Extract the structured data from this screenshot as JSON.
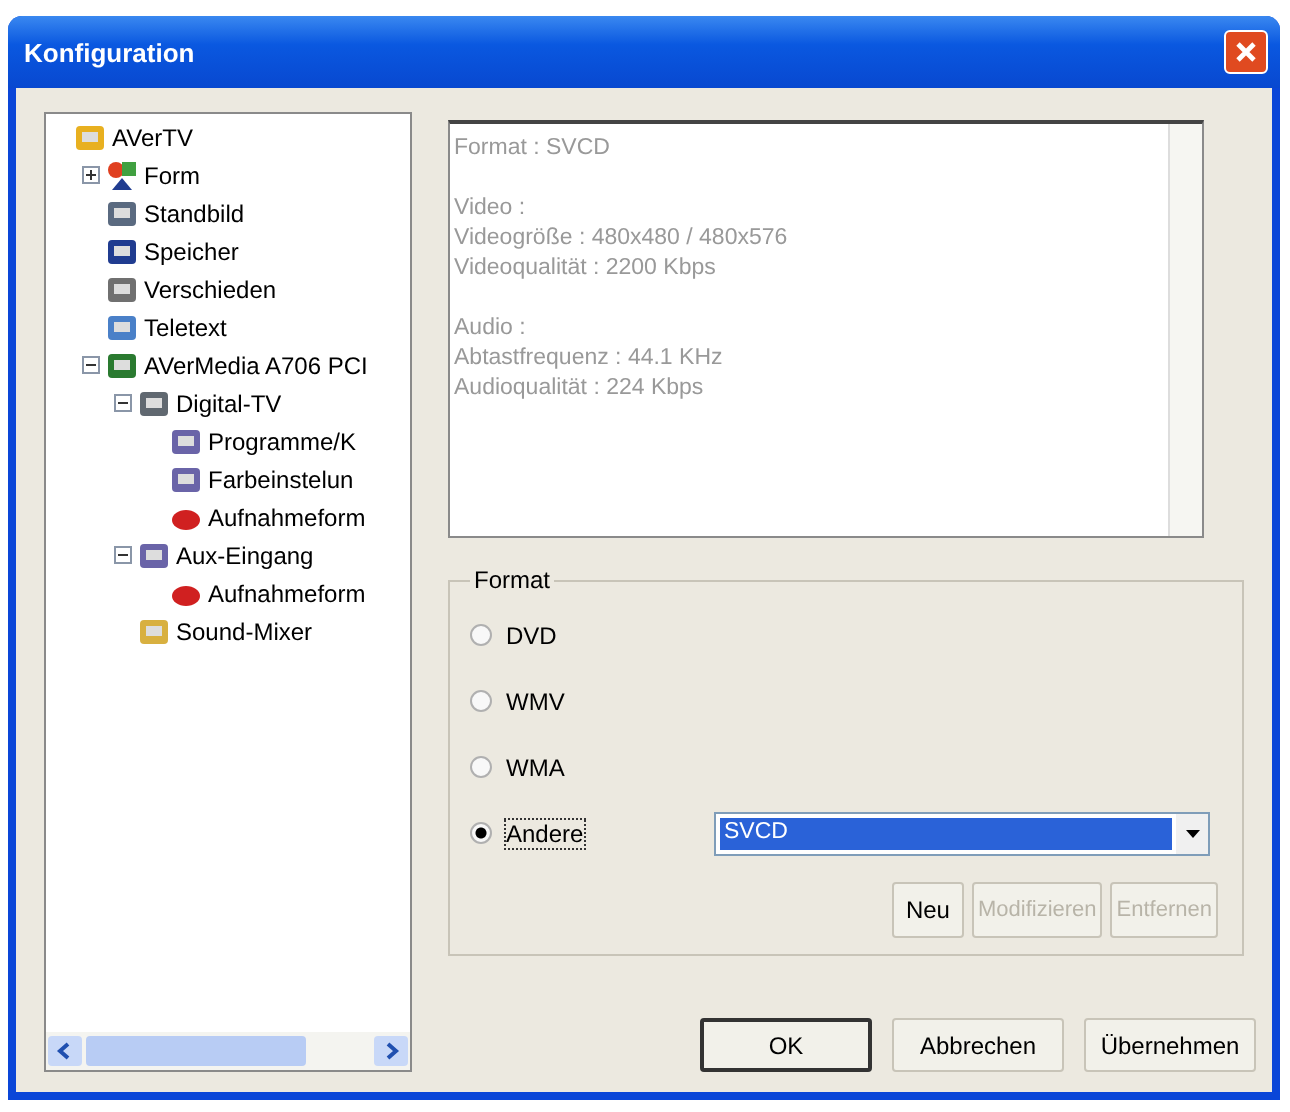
{
  "window": {
    "title": "Konfiguration"
  },
  "tree": [
    {
      "label": "AVerTV",
      "children": [
        {
          "label": "Form",
          "expanded": false
        },
        {
          "label": "Standbild"
        },
        {
          "label": "Speicher"
        },
        {
          "label": "Verschieden"
        },
        {
          "label": "Teletext"
        },
        {
          "label": "AVerMedia A706 PCI",
          "expanded": true,
          "children": [
            {
              "label": "Digital-TV",
              "expanded": true,
              "children": [
                {
                  "label": "Programme/K"
                },
                {
                  "label": "Farbeinstelun"
                },
                {
                  "label": "Aufnahmeform"
                }
              ]
            },
            {
              "label": "Aux-Eingang",
              "expanded": true,
              "children": [
                {
                  "label": "Aufnahmeform"
                }
              ]
            },
            {
              "label": "Sound-Mixer"
            }
          ]
        }
      ]
    }
  ],
  "info_blocks": [
    [
      "Format : SVCD"
    ],
    [
      "Video :",
      "Videogröße : 480x480 / 480x576",
      "Videoqualität : 2200 Kbps"
    ],
    [
      "Audio :",
      "Abtastfrequenz : 44.1 KHz",
      "Audioqualität : 224 Kbps"
    ]
  ],
  "format_group": {
    "title": "Format",
    "options": [
      {
        "label": "DVD",
        "selected": false
      },
      {
        "label": "WMV",
        "selected": false
      },
      {
        "label": "WMA",
        "selected": false
      },
      {
        "label": "Andere",
        "selected": true
      }
    ],
    "dropdown": {
      "value": "SVCD"
    },
    "buttons": [
      {
        "label": "Neu",
        "disabled": false
      },
      {
        "label": "Modifizieren",
        "disabled": true
      },
      {
        "label": "Entfernen",
        "disabled": true
      }
    ]
  },
  "dialog_buttons": [
    {
      "label": "OK",
      "default": true
    },
    {
      "label": "Abbrechen",
      "default": false
    },
    {
      "label": "Übernehmen",
      "default": false
    }
  ]
}
